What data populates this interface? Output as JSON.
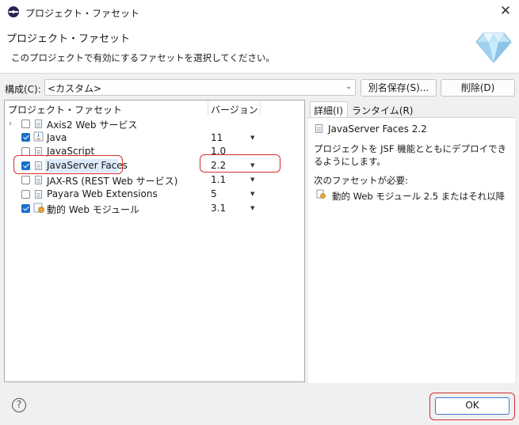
{
  "window": {
    "title": "プロジェクト・ファセット"
  },
  "banner": {
    "title": "プロジェクト・ファセット",
    "description": "このプロジェクトで有効にするファセットを選択してください。"
  },
  "config": {
    "label": "構成(C):",
    "value": "<カスタム>",
    "save_as_label": "別名保存(S)...",
    "delete_label": "削除(D)"
  },
  "tree": {
    "col_facet": "プロジェクト・ファセット",
    "col_version": "バージョン",
    "rows": [
      {
        "label": "Axis2 Web サービス",
        "version": "",
        "checked": false,
        "icon": "folder-expander"
      },
      {
        "label": "Java",
        "version": "11",
        "checked": true,
        "icon": "java-icon"
      },
      {
        "label": "JavaScript",
        "version": "1.0",
        "checked": false,
        "icon": "document-icon"
      },
      {
        "label": "JavaServer Faces",
        "version": "2.2",
        "checked": true,
        "icon": "document-icon"
      },
      {
        "label": "JAX-RS (REST Web サービス)",
        "version": "1.1",
        "checked": false,
        "icon": "document-icon"
      },
      {
        "label": "Payara Web Extensions",
        "version": "5",
        "checked": false,
        "icon": "document-icon"
      },
      {
        "label": "動的 Web モジュール",
        "version": "3.1",
        "checked": true,
        "icon": "web-module-icon"
      }
    ]
  },
  "details": {
    "tab_details": "詳細(I)",
    "tab_runtime": "ランタイム(R)",
    "facet_title": "JavaServer Faces 2.2",
    "description": "プロジェクトを JSF 機能とともにデプロイできるようにします。",
    "requires_label": "次のファセットが必要:",
    "requires_item": "動的 Web モジュール 2.5 またはそれ以降"
  },
  "footer": {
    "help_label": "?",
    "ok_label": "OK"
  },
  "colors": {
    "accent": "#1b6fc8",
    "highlight_box": "#d32f2f"
  }
}
